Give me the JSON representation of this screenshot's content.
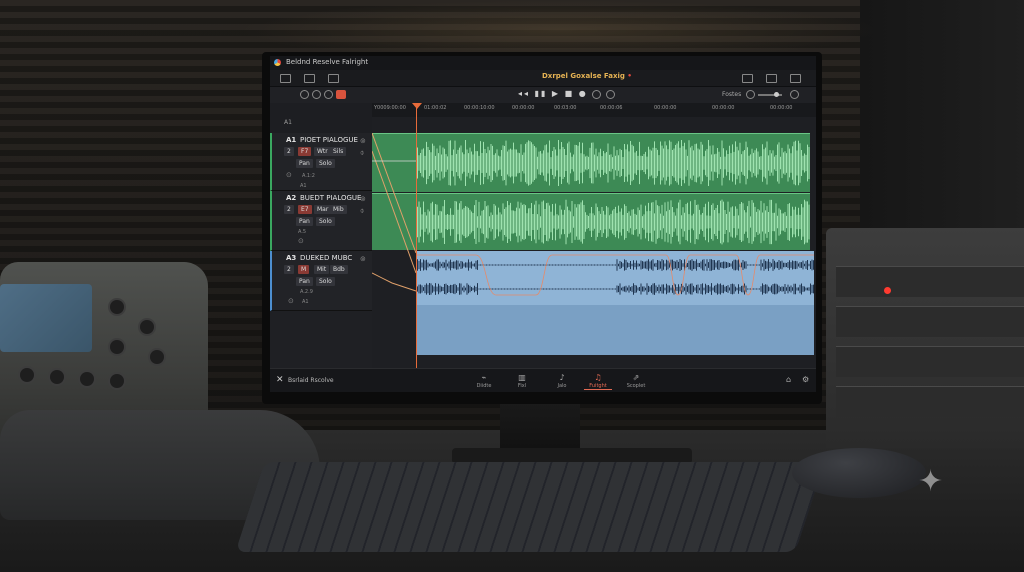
{
  "app": {
    "title": "Beldnd Reselve Falright",
    "center_title": "Dxrpel Goxalse Faxig",
    "center_rec": "•",
    "brand": "Bsrlaid Rscolve"
  },
  "toolbar": {
    "right_label": "Fostes"
  },
  "ruler": {
    "ticks": [
      "Y0009:00:00",
      "01:00:02",
      "00:00:10:00",
      "00:00:00",
      "00:03:00",
      "00:00:06",
      "00:00:00",
      "00:00:00",
      "00:00:00"
    ]
  },
  "tracks": [
    {
      "id": "A1",
      "name": "PIOET PIALOGUE",
      "btn1": "2",
      "btn2": "F7",
      "btn3": "Wtr",
      "btn4": "Sils",
      "pan": "Pan",
      "solo": "Solo",
      "label": "A1",
      "small": "A.1:2"
    },
    {
      "id": "A2",
      "name": "BUEDT PIALOGUE",
      "btn1": "2",
      "btn2": "E7",
      "btn3": "Mar",
      "btn4": "Mib",
      "pan": "Pan",
      "solo": "Solo",
      "label": "A1",
      "small": "A.5"
    },
    {
      "id": "A3",
      "name": "DUEKED MUBC",
      "btn1": "2",
      "btn2": "M",
      "btn3": "Mit",
      "btn4": "Bdb",
      "pan": "Pan",
      "solo": "Solo",
      "label": "A1",
      "small": "A.2.9"
    }
  ],
  "top_track_label": "A1",
  "pages": [
    {
      "label": "Diidte",
      "icon": "⌁",
      "active": false
    },
    {
      "label": "Fixl",
      "icon": "▥",
      "active": false
    },
    {
      "label": "Jalo",
      "icon": "♪",
      "active": false
    },
    {
      "label": "Fuitght",
      "icon": "♫",
      "active": true
    },
    {
      "label": "Scoplet",
      "icon": "⇗",
      "active": false
    }
  ],
  "icons": {
    "logo": "resolve-logo-icon",
    "sparkle": "sparkle-icon"
  },
  "colors": {
    "dialogue_clip": "#3d8a55",
    "music_clip": "#8fb4d6",
    "playhead": "#e76b3a",
    "active_page": "#e56b54"
  }
}
